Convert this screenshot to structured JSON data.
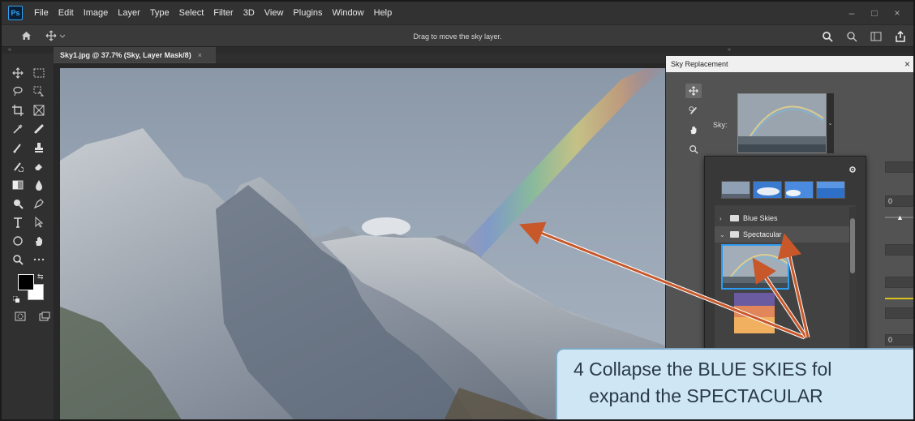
{
  "menubar": {
    "logo": "Ps",
    "items": [
      "File",
      "Edit",
      "Image",
      "Layer",
      "Type",
      "Select",
      "Filter",
      "3D",
      "View",
      "Plugins",
      "Window",
      "Help"
    ],
    "window_controls": [
      "–",
      "□",
      "×"
    ]
  },
  "options_bar": {
    "hint": "Drag to move the sky layer."
  },
  "document": {
    "tab_title": "Sky1.jpg @ 37.7% (Sky, Layer Mask/8)",
    "tab_close": "×"
  },
  "dialog": {
    "title": "Sky Replacement",
    "close": "×",
    "sky_label": "Sky:",
    "tools": [
      "move-sky-tool",
      "sky-brush-tool",
      "hand-tool",
      "zoom-tool"
    ],
    "field_values": [
      "",
      "0",
      "",
      "",
      "",
      "0",
      ""
    ],
    "popover": {
      "folders": [
        {
          "name": "Blue Skies",
          "expanded": false
        },
        {
          "name": "Spectacular",
          "expanded": true
        }
      ]
    }
  },
  "caption": {
    "line1": "4 Collapse the BLUE SKIES fol",
    "line2": "   expand the SPECTACULAR"
  },
  "colors": {
    "accent_blue": "#2d9bf0",
    "arrow": "#c8572a",
    "callout_bg": "#cfe6f5"
  }
}
